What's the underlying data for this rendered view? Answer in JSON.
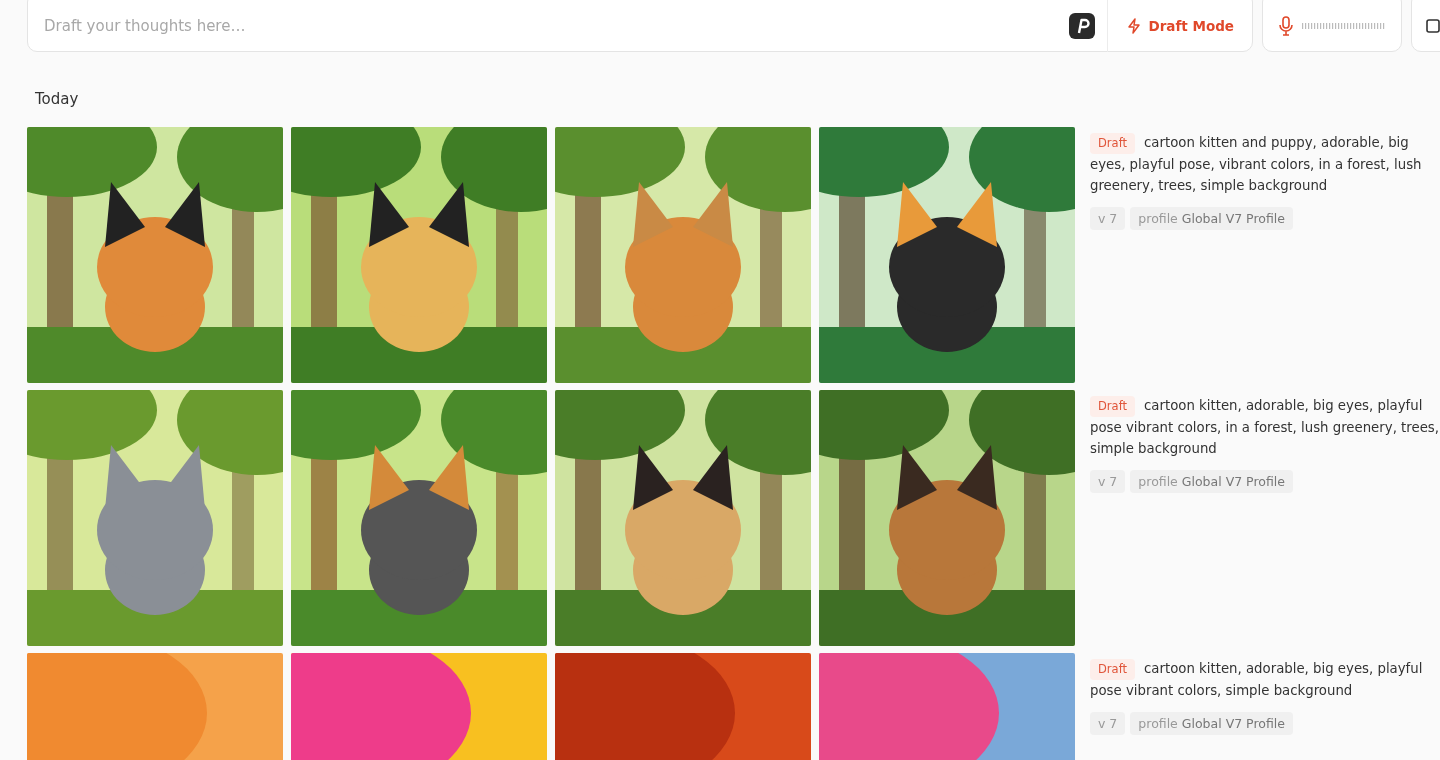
{
  "prompt_bar": {
    "placeholder": "Draft your thoughts here…",
    "mode_button": "Draft Mode"
  },
  "sections": [
    {
      "heading": "Today",
      "jobs": [
        {
          "badge": "Draft",
          "prompt": "cartoon kitten and puppy, adorable, big eyes, playful pose, vibrant colors, in a forest, lush greenery, trees, simple background",
          "version": "v 7",
          "profile_label": "profile",
          "profile": "Global V7 Profile"
        },
        {
          "badge": "Draft",
          "prompt": "cartoon kitten, adorable, big eyes, playful pose vibrant colors, in a forest, lush greenery, trees, simple background",
          "version": "v 7",
          "profile_label": "profile",
          "profile": "Global V7 Profile"
        },
        {
          "badge": "Draft",
          "prompt": "cartoon kitten, adorable, big eyes, playful pose vibrant colors, simple background",
          "version": "v 7",
          "profile_label": "profile",
          "profile": "Global V7 Profile"
        }
      ]
    }
  ]
}
